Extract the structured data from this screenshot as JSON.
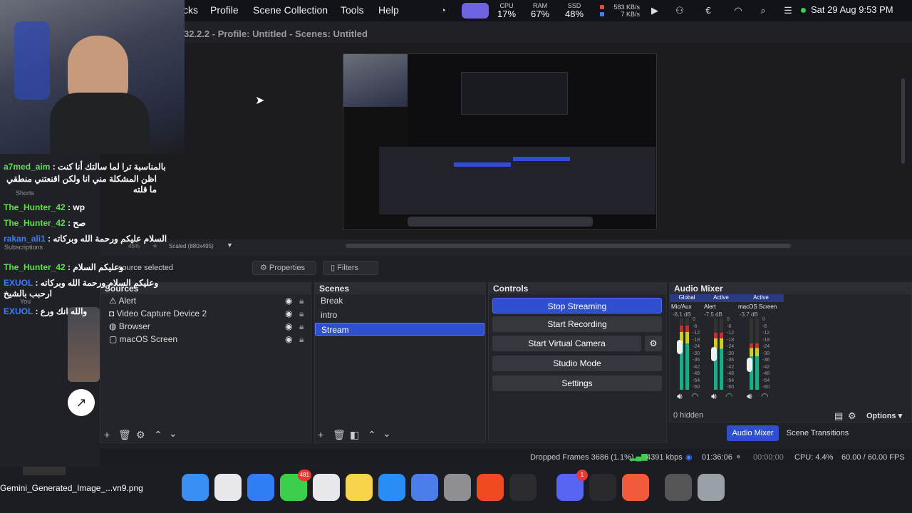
{
  "menubar": {
    "items": [
      "cks",
      "Profile",
      "Scene Collection",
      "Tools",
      "Help"
    ],
    "cpu": {
      "label": "CPU",
      "value": "17%"
    },
    "ram": {
      "label": "RAM",
      "value": "67%"
    },
    "ssd": {
      "label": "SSD",
      "value": "48%"
    },
    "net_up": "583 KB/s",
    "net_down": "7 KB/s",
    "datetime": "Sat 29 Aug  9:53 PM"
  },
  "window": {
    "title": "32.2.2 - Profile: Untitled - Scenes: Untitled"
  },
  "preview": {
    "scale_label": "Scaled (880x495)",
    "zoom": "45%"
  },
  "toolbar": {
    "no_source": "source selected",
    "properties": "Properties",
    "filters": "Filters"
  },
  "sources": {
    "title": "Sources",
    "items": [
      {
        "label": "Alert",
        "icon": "alert-icon"
      },
      {
        "label": "Video Capture Device 2",
        "icon": "camera-icon"
      },
      {
        "label": "Browser",
        "icon": "globe-icon"
      },
      {
        "label": "macOS Screen",
        "icon": "monitor-icon"
      }
    ]
  },
  "scenes": {
    "title": "Scenes",
    "items": [
      "Break",
      "intro",
      "Stream"
    ],
    "selected": "Stream"
  },
  "controls": {
    "title": "Controls",
    "stop_streaming": "Stop Streaming",
    "start_recording": "Start Recording",
    "start_virtual_camera": "Start Virtual Camera",
    "studio_mode": "Studio Mode",
    "settings": "Settings"
  },
  "mixer": {
    "title": "Audio Mixer",
    "channels": [
      {
        "scope": "Global",
        "name": "Mic/Aux",
        "db": "-6.1 dB",
        "level": 0.9
      },
      {
        "scope": "Active",
        "name": "Alert",
        "db": "-7.5 dB",
        "level": 0.8
      },
      {
        "scope": "Active",
        "name": "macOS Screen",
        "db": "-3.7 dB",
        "level": 0.65
      }
    ],
    "scale": [
      "0",
      "-6",
      "-12",
      "-18",
      "-24",
      "-30",
      "-36",
      "-42",
      "-48",
      "-54",
      "-60"
    ],
    "hidden": "0 hidden",
    "options": "Options",
    "tab_audio_mixer": "Audio Mixer",
    "tab_scene_transitions": "Scene Transitions"
  },
  "status": {
    "dropped": "Dropped Frames 3686 (1.1%)",
    "kbps": "4391 kbps",
    "live_time": "01:36:06",
    "rec_time": "00:00:00",
    "cpu": "CPU: 4.4%",
    "fps": "60.00 / 60.00 FPS"
  },
  "chat": {
    "messages": [
      {
        "user": "a7med_aim",
        "text": "بالمناسبة ترا لما سالتك أنا كنت",
        "color": "#5ee04a"
      },
      {
        "user": "",
        "text": "اظن المشكلة مني انا ولكن اقنعتني منطقي ما قلته",
        "color": "#5ee04a"
      },
      {
        "user": "The_Hunter_42",
        "text": "wp",
        "color": "#5ee04a"
      },
      {
        "user": "The_Hunter_42",
        "text": "صح",
        "color": "#5ee04a"
      },
      {
        "user": "rakan_ali1",
        "text": "السلام عليكم ورحمة الله وبركاته",
        "color": "#3d7bff"
      },
      {
        "user": "The_Hunter_42",
        "text": "وعليكم السلام",
        "color": "#5ee04a"
      },
      {
        "user": "EXUOL",
        "text": "وعليكم السلام ورحمة الله وبركاته ارحبب بالشيخ",
        "color": "#3d7bff"
      },
      {
        "user": "EXUOL",
        "text": "والله انك ورع",
        "color": "#3d7bff"
      }
    ],
    "side_labels": {
      "shorts": "Shorts",
      "subscriptions": "Subscriptions",
      "you": "You"
    }
  },
  "desktop_file": {
    "name": "Gemini_Generated_Image_...vn9.png"
  },
  "dock": {
    "apps": [
      {
        "name": "finder",
        "color": "#3a8ff5"
      },
      {
        "name": "launchpad",
        "color": "#e8e8ec"
      },
      {
        "name": "safari",
        "color": "#2f7ff2"
      },
      {
        "name": "messages",
        "color": "#3ccf4e",
        "badge": "481"
      },
      {
        "name": "chrome",
        "color": "#e8e8ec"
      },
      {
        "name": "notes",
        "color": "#f7d44c"
      },
      {
        "name": "app-store",
        "color": "#2a8df5"
      },
      {
        "name": "simulator",
        "color": "#4b7ee8"
      },
      {
        "name": "system-settings",
        "color": "#8e8e93"
      },
      {
        "name": "brave",
        "color": "#f04a20"
      },
      {
        "name": "obs",
        "color": "#2b2b30"
      },
      {
        "name": "discord",
        "color": "#5865f2",
        "badge": "1"
      },
      {
        "name": "keychain",
        "color": "#2a2a2e"
      },
      {
        "name": "burst-app",
        "color": "#f25a3c"
      },
      {
        "name": "storage",
        "color": "#555"
      },
      {
        "name": "trash",
        "color": "#9aa0a8"
      }
    ]
  }
}
